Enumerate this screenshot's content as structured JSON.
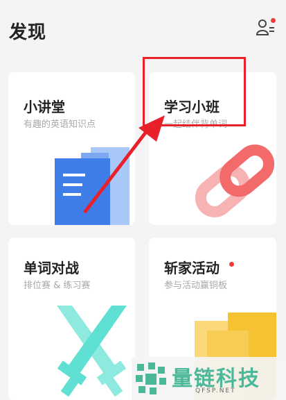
{
  "header": {
    "title": "发现"
  },
  "icons": {
    "friends": "person-list-icon",
    "notification": "red-dot-icon"
  },
  "cards": [
    {
      "title": "小讲堂",
      "subtitle": "有趣的英语知识点",
      "icon": "book-pages-icon"
    },
    {
      "title": "学习小班",
      "subtitle": "一起结伴背单词",
      "icon": "chain-link-icon"
    },
    {
      "title": "单词对战",
      "subtitle": "排位赛 & 练习赛",
      "icon": "crossed-swords-icon"
    },
    {
      "title": "斩家活动",
      "subtitle": "参与活动赢铜板",
      "icon": "folders-icon",
      "badge": true
    }
  ],
  "watermark": {
    "text": "量链科技",
    "url": "QFSP.NET"
  },
  "colors": {
    "accent_red": "#e8202a",
    "book_blue": "#3f7ee8",
    "chain_red": "#f26a6a",
    "swords_teal": "#5fe0d2",
    "folder_yellow": "#f7c232",
    "watermark_green": "#4bb89a"
  }
}
